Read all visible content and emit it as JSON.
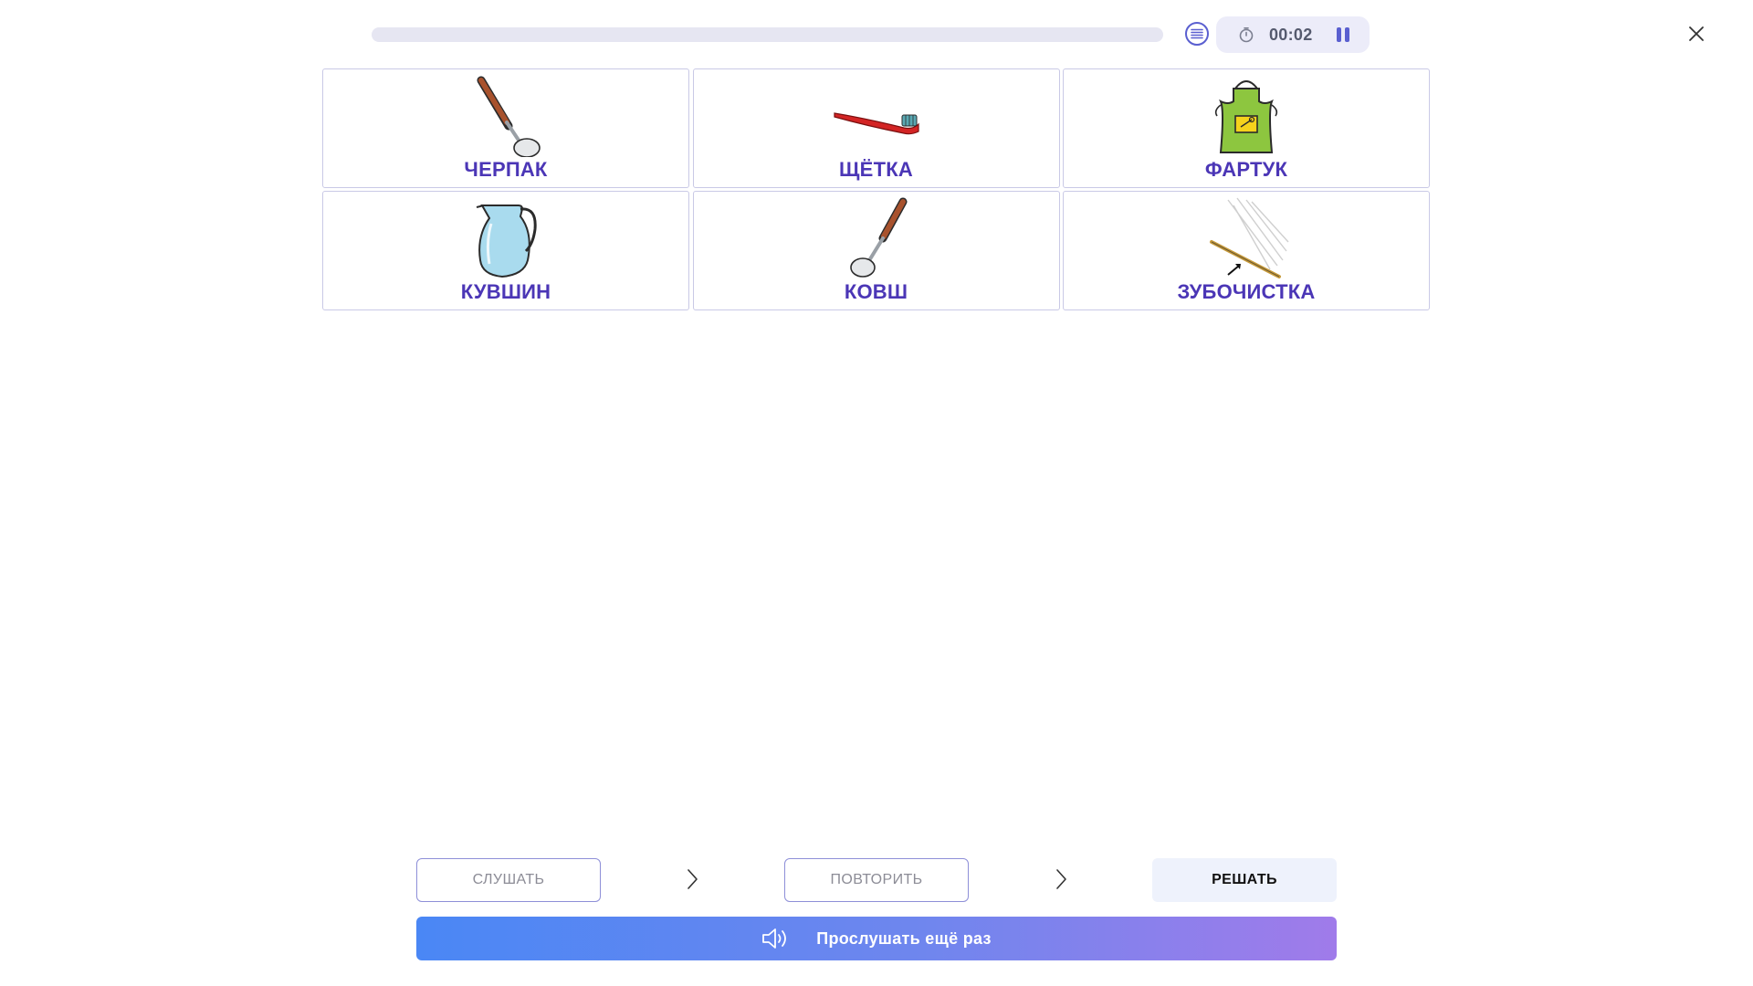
{
  "header": {
    "progress_fraction": 0.0,
    "timer": "00:02",
    "icons": {
      "list": "list-icon",
      "timer": "stopwatch-icon",
      "pause": "pause-icon",
      "close": "close-icon"
    }
  },
  "cards": [
    {
      "label": "ЧЕРПАК",
      "icon": "ladle-icon"
    },
    {
      "label": "ЩЁТКА",
      "icon": "toothbrush-icon"
    },
    {
      "label": "ФАРТУК",
      "icon": "apron-icon"
    },
    {
      "label": "КУВШИН",
      "icon": "jug-icon"
    },
    {
      "label": "КОВШ",
      "icon": "dipper-icon"
    },
    {
      "label": "ЗУБОЧИСТКА",
      "icon": "toothpick-icon"
    }
  ],
  "steps": {
    "listen": "СЛУШАТЬ",
    "repeat": "ПОВТОРИТЬ",
    "solve": "РЕШАТЬ"
  },
  "listen_again": {
    "label": "Прослушать ещё раз",
    "icon": "speaker-icon"
  },
  "colors": {
    "accent": "#5a5fd0",
    "card_label": "#4b36b6",
    "gradient_start": "#4a87f5",
    "gradient_end": "#a07bea"
  }
}
